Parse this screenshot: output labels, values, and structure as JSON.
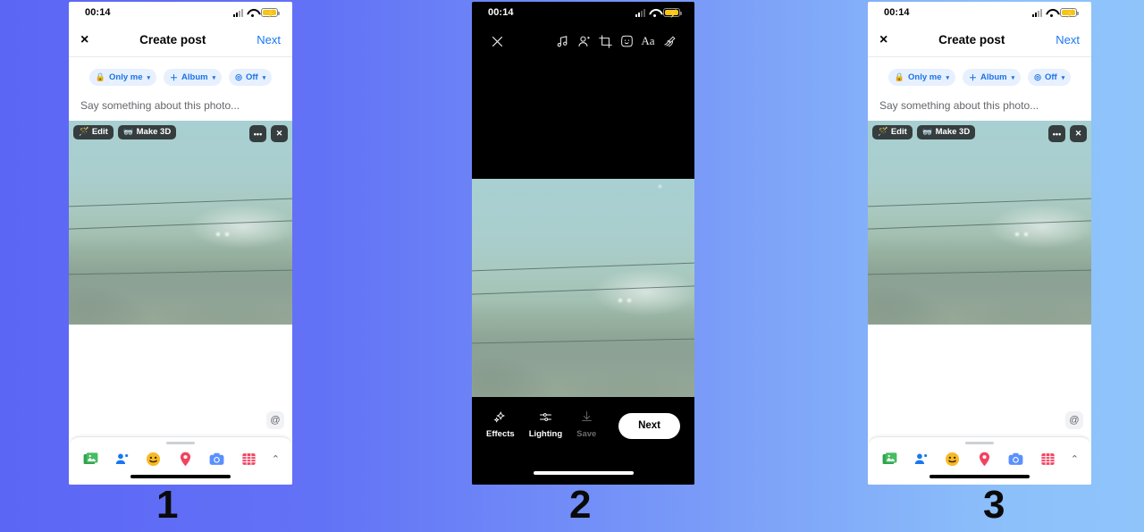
{
  "background": {
    "gradient_from": "#5c66f5",
    "gradient_to": "#8fc4fb"
  },
  "panels": [
    {
      "number": "1",
      "type": "create-post",
      "status_bar": {
        "clock": "00:14",
        "signal": "signal-icon",
        "wifi": "wifi-icon",
        "battery": "battery-charging-icon"
      },
      "navbar": {
        "close": "×",
        "title": "Create post",
        "next": "Next"
      },
      "chips": [
        {
          "icon": "lock-icon",
          "label": "Only me",
          "caret": "▾"
        },
        {
          "icon": "plus-icon",
          "label": "Album",
          "caret": "▾"
        },
        {
          "icon": "timer-icon",
          "label": "Off",
          "caret": "▾"
        }
      ],
      "composer": {
        "placeholder": "Say something about this photo..."
      },
      "photo_overlay": {
        "edit": "Edit",
        "make3d": "Make 3D",
        "more": "•••",
        "remove": "✕"
      },
      "mention": "@",
      "tabbar": [
        {
          "name": "photos-icon"
        },
        {
          "name": "tag-people-icon"
        },
        {
          "name": "feeling-icon"
        },
        {
          "name": "location-icon"
        },
        {
          "name": "camera-icon"
        },
        {
          "name": "gif-icon"
        },
        {
          "name": "expand-chevron-icon"
        }
      ]
    },
    {
      "number": "2",
      "type": "photo-editor",
      "status_bar": {
        "clock": "00:14",
        "signal": "signal-icon",
        "wifi": "wifi-icon",
        "battery": "battery-charging-icon"
      },
      "tools": [
        {
          "name": "close-icon"
        },
        {
          "name": "music-icon"
        },
        {
          "name": "tag-person-icon"
        },
        {
          "name": "crop-icon"
        },
        {
          "name": "sticker-icon"
        },
        {
          "name": "text-icon",
          "label": "Aa"
        },
        {
          "name": "doodle-icon"
        }
      ],
      "actions": [
        {
          "icon": "sparkles-icon",
          "label": "Effects",
          "disabled": false
        },
        {
          "icon": "sliders-icon",
          "label": "Lighting",
          "disabled": false
        },
        {
          "icon": "download-icon",
          "label": "Save",
          "disabled": true
        }
      ],
      "next_button": "Next"
    },
    {
      "number": "3",
      "type": "create-post",
      "status_bar": {
        "clock": "00:14",
        "signal": "signal-icon",
        "wifi": "wifi-icon",
        "battery": "battery-charging-icon"
      },
      "navbar": {
        "close": "×",
        "title": "Create post",
        "next": "Next"
      },
      "chips": [
        {
          "icon": "lock-icon",
          "label": "Only me",
          "caret": "▾"
        },
        {
          "icon": "plus-icon",
          "label": "Album",
          "caret": "▾"
        },
        {
          "icon": "timer-icon",
          "label": "Off",
          "caret": "▾"
        }
      ],
      "composer": {
        "placeholder": "Say something about this photo..."
      },
      "photo_overlay": {
        "edit": "Edit",
        "make3d": "Make 3D",
        "more": "•••",
        "remove": "✕"
      },
      "mention": "@",
      "tabbar": [
        {
          "name": "photos-icon"
        },
        {
          "name": "tag-people-icon"
        },
        {
          "name": "feeling-icon"
        },
        {
          "name": "location-icon"
        },
        {
          "name": "camera-icon"
        },
        {
          "name": "gif-icon"
        },
        {
          "name": "expand-chevron-icon"
        }
      ]
    }
  ],
  "colors": {
    "accent_blue": "#1877f2",
    "chip_bg": "#e7f0fe",
    "chip_text": "#1b74e4",
    "placeholder": "#65676b",
    "battery_yellow": "#f5c518"
  }
}
